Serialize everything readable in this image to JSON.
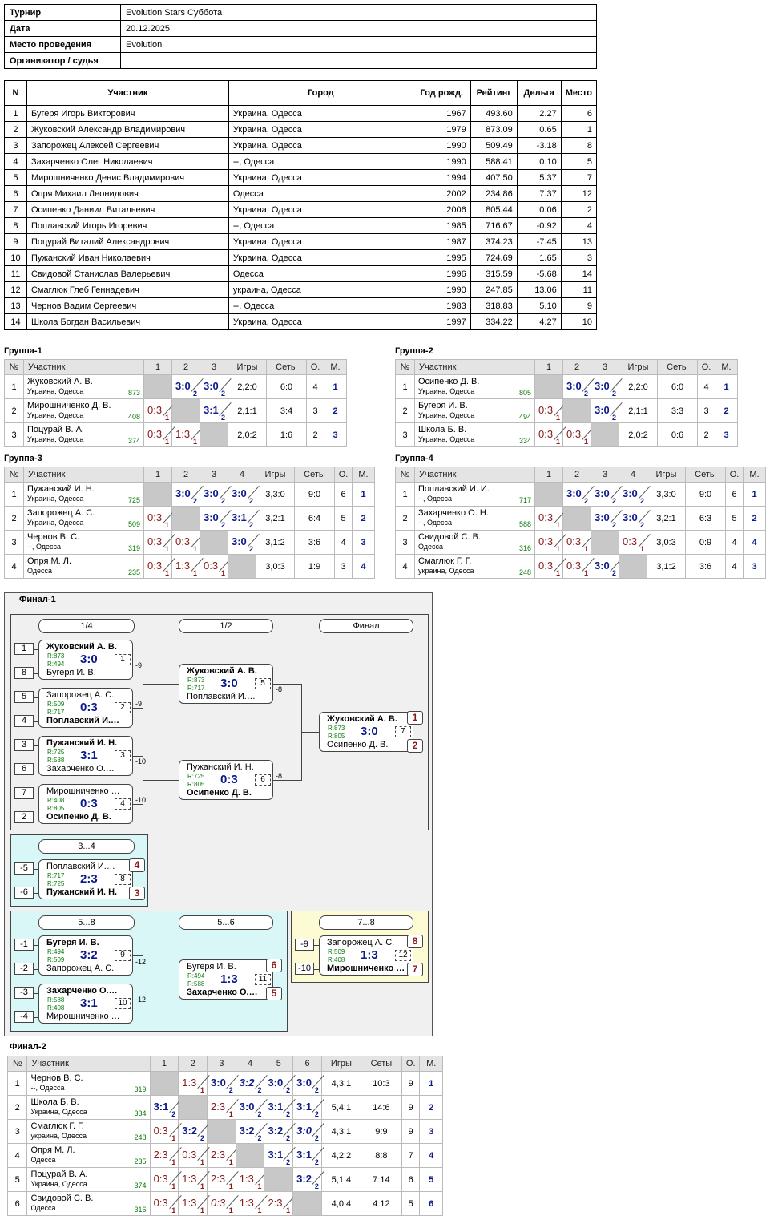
{
  "info": [
    {
      "k": "Турнир",
      "v": "Evolution Stars Суббота"
    },
    {
      "k": "Дата",
      "v": "20.12.2025"
    },
    {
      "k": "Место проведения",
      "v": "Evolution"
    },
    {
      "k": "Организатор / судья",
      "v": ""
    }
  ],
  "players_header": [
    "N",
    "Участник",
    "Город",
    "Год рожд.",
    "Рейтинг",
    "Дельта",
    "Место"
  ],
  "players": [
    [
      "1",
      "Бугеря Игорь Викторович",
      "Украина, Одесса",
      "1967",
      "493.60",
      "2.27",
      "6"
    ],
    [
      "2",
      "Жуковский Александр Владимирович",
      "Украина, Одесса",
      "1979",
      "873.09",
      "0.65",
      "1"
    ],
    [
      "3",
      "Запорожец Алексей Сергеевич",
      "Украина, Одесса",
      "1990",
      "509.49",
      "-3.18",
      "8"
    ],
    [
      "4",
      "Захарченко Олег Николаевич",
      "--, Одесса",
      "1990",
      "588.41",
      "0.10",
      "5"
    ],
    [
      "5",
      "Мирошниченко Денис Владимирович",
      "Украина, Одесса",
      "1994",
      "407.50",
      "5.37",
      "7"
    ],
    [
      "6",
      "Опря Михаил Леонидович",
      "Одесса",
      "2002",
      "234.86",
      "7.37",
      "12"
    ],
    [
      "7",
      "Осипенко Даниил Витальевич",
      "Украина, Одесса",
      "2006",
      "805.44",
      "0.06",
      "2"
    ],
    [
      "8",
      "Поплавский Игорь Игоревич",
      "--, Одесса",
      "1985",
      "716.67",
      "-0.92",
      "4"
    ],
    [
      "9",
      "Поцурай Виталий Александрович",
      "Украина, Одесса",
      "1987",
      "374.23",
      "-7.45",
      "13"
    ],
    [
      "10",
      "Пужанский Иван Николаевич",
      "Украина, Одесса",
      "1995",
      "724.69",
      "1.65",
      "3"
    ],
    [
      "11",
      "Свидовой Станислав Валерьевич",
      "Одесса",
      "1996",
      "315.59",
      "-5.68",
      "14"
    ],
    [
      "12",
      "Смаглюк Глеб Геннадевич",
      "украина, Одесса",
      "1990",
      "247.85",
      "13.06",
      "11"
    ],
    [
      "13",
      "Чернов Вадим Сергеевич",
      "--, Одесса",
      "1983",
      "318.83",
      "5.10",
      "9"
    ],
    [
      "14",
      "Школа Богдан Васильевич",
      "Украина, Одесса",
      "1997",
      "334.22",
      "4.27",
      "10"
    ]
  ],
  "grid_header": {
    "n": "№",
    "name": "Участник",
    "games": "Игры",
    "sets": "Сеты",
    "pts": "О.",
    "place": "М."
  },
  "groups": [
    {
      "title": "Группа-1",
      "rows": [
        {
          "n": "1",
          "name": "Жуковский А. В.",
          "city": "Украина, Одесса",
          "rating": "873",
          "res": [
            "X",
            "3:0|2|w",
            "3:0|2|w"
          ],
          "games": "2,2:0",
          "sets": "6:0",
          "pts": "4",
          "place": "1"
        },
        {
          "n": "2",
          "name": "Мирошниченко Д. В.",
          "city": "Украина, Одесса",
          "rating": "408",
          "res": [
            "0:3|1|l",
            "X",
            "3:1|2|w"
          ],
          "games": "2,1:1",
          "sets": "3:4",
          "pts": "3",
          "place": "2"
        },
        {
          "n": "3",
          "name": "Поцурай В. А.",
          "city": "Украина, Одесса",
          "rating": "374",
          "res": [
            "0:3|1|l",
            "1:3|1|l",
            "X"
          ],
          "games": "2,0:2",
          "sets": "1:6",
          "pts": "2",
          "place": "3"
        }
      ]
    },
    {
      "title": "Группа-2",
      "rows": [
        {
          "n": "1",
          "name": "Осипенко Д. В.",
          "city": "Украина, Одесса",
          "rating": "805",
          "res": [
            "X",
            "3:0|2|w",
            "3:0|2|w"
          ],
          "games": "2,2:0",
          "sets": "6:0",
          "pts": "4",
          "place": "1"
        },
        {
          "n": "2",
          "name": "Бугеря И. В.",
          "city": "Украина, Одесса",
          "rating": "494",
          "res": [
            "0:3|1|l",
            "X",
            "3:0|2|w"
          ],
          "games": "2,1:1",
          "sets": "3:3",
          "pts": "3",
          "place": "2"
        },
        {
          "n": "3",
          "name": "Школа Б. В.",
          "city": "Украина, Одесса",
          "rating": "334",
          "res": [
            "0:3|1|l",
            "0:3|1|l",
            "X"
          ],
          "games": "2,0:2",
          "sets": "0:6",
          "pts": "2",
          "place": "3"
        }
      ]
    },
    {
      "title": "Группа-3",
      "rows": [
        {
          "n": "1",
          "name": "Пужанский И. Н.",
          "city": "Украина, Одесса",
          "rating": "725",
          "res": [
            "X",
            "3:0|2|w",
            "3:0|2|w",
            "3:0|2|w"
          ],
          "games": "3,3:0",
          "sets": "9:0",
          "pts": "6",
          "place": "1"
        },
        {
          "n": "2",
          "name": "Запорожец А. С.",
          "city": "Украина, Одесса",
          "rating": "509",
          "res": [
            "0:3|1|l",
            "X",
            "3:0|2|w",
            "3:1|2|w"
          ],
          "games": "3,2:1",
          "sets": "6:4",
          "pts": "5",
          "place": "2"
        },
        {
          "n": "3",
          "name": "Чернов В. С.",
          "city": "--, Одесса",
          "rating": "319",
          "res": [
            "0:3|1|l",
            "0:3|1|l",
            "X",
            "3:0|2|w"
          ],
          "games": "3,1:2",
          "sets": "3:6",
          "pts": "4",
          "place": "3"
        },
        {
          "n": "4",
          "name": "Опря М. Л.",
          "city": "Одесса",
          "rating": "235",
          "res": [
            "0:3|1|l",
            "1:3|1|l",
            "0:3|1|l",
            "X"
          ],
          "games": "3,0:3",
          "sets": "1:9",
          "pts": "3",
          "place": "4"
        }
      ]
    },
    {
      "title": "Группа-4",
      "rows": [
        {
          "n": "1",
          "name": "Поплавский И. И.",
          "city": "--, Одесса",
          "rating": "717",
          "res": [
            "X",
            "3:0|2|w",
            "3:0|2|w",
            "3:0|2|w"
          ],
          "games": "3,3:0",
          "sets": "9:0",
          "pts": "6",
          "place": "1"
        },
        {
          "n": "2",
          "name": "Захарченко О. Н.",
          "city": "--, Одесса",
          "rating": "588",
          "res": [
            "0:3|1|l",
            "X",
            "3:0|2|w",
            "3:0|2|w"
          ],
          "games": "3,2:1",
          "sets": "6:3",
          "pts": "5",
          "place": "2"
        },
        {
          "n": "3",
          "name": "Свидовой С. В.",
          "city": "Одесса",
          "rating": "316",
          "res": [
            "0:3|1|l",
            "0:3|1|l",
            "X",
            "0:3|1|l"
          ],
          "games": "3,0:3",
          "sets": "0:9",
          "pts": "4",
          "place": "4"
        },
        {
          "n": "4",
          "name": "Смаглюк Г. Г.",
          "city": "украина, Одесса",
          "rating": "248",
          "res": [
            "0:3|1|l",
            "0:3|1|l",
            "3:0|2|w",
            "X"
          ],
          "games": "3,1:2",
          "sets": "3:6",
          "pts": "4",
          "place": "3"
        }
      ]
    }
  ],
  "final1": {
    "title": "Финал-1",
    "stages": [
      "1/4",
      "1/2",
      "Финал",
      "3...4",
      "5...8",
      "5...6",
      "7...8"
    ],
    "seeds": [
      "1",
      "8",
      "5",
      "4",
      "3",
      "6",
      "7",
      "2",
      "-5",
      "-6",
      "-1",
      "-2",
      "-3",
      "-4",
      "-9",
      "-10"
    ],
    "matches": [
      {
        "a": "Жуковский А. В.",
        "ra": "R:873",
        "b": "Бугеря И. В.",
        "rb": "R:494",
        "score": "3:0",
        "num": "1",
        "win": "a"
      },
      {
        "a": "Запорожец А. С.",
        "ra": "R:509",
        "b": "Поплавский И.…",
        "rb": "R:717",
        "score": "0:3",
        "num": "2",
        "win": "b"
      },
      {
        "a": "Пужанский И. Н.",
        "ra": "R:725",
        "b": "Захарченко О.…",
        "rb": "R:588",
        "score": "3:1",
        "num": "3",
        "win": "a"
      },
      {
        "a": "Мирошниченко …",
        "ra": "R:408",
        "b": "Осипенко Д. В.",
        "rb": "R:805",
        "score": "0:3",
        "num": "4",
        "win": "b"
      },
      {
        "a": "Жуковский А. В.",
        "ra": "R:873",
        "b": "Поплавский И.…",
        "rb": "R:717",
        "score": "3:0",
        "num": "5",
        "win": "a"
      },
      {
        "a": "Пужанский И. Н.",
        "ra": "R:725",
        "b": "Осипенко Д. В.",
        "rb": "R:805",
        "score": "0:3",
        "num": "6",
        "win": "b"
      },
      {
        "a": "Жуковский А. В.",
        "ra": "R:873",
        "b": "Осипенко Д. В.",
        "rb": "R:805",
        "score": "3:0",
        "num": "7",
        "win": "a"
      },
      {
        "a": "Поплавский И.…",
        "ra": "R:717",
        "b": "Пужанский И. Н.",
        "rb": "R:725",
        "score": "2:3",
        "num": "8",
        "win": "b"
      },
      {
        "a": "Бугеря И. В.",
        "ra": "R:494",
        "b": "Запорожец А. С.",
        "rb": "R:509",
        "score": "3:2",
        "num": "9",
        "win": "a"
      },
      {
        "a": "Захарченко О.…",
        "ra": "R:588",
        "b": "Мирошниченко …",
        "rb": "R:408",
        "score": "3:1",
        "num": "10",
        "win": "a"
      },
      {
        "a": "Бугеря И. В.",
        "ra": "R:494",
        "b": "Захарченко О.…",
        "rb": "R:588",
        "score": "1:3",
        "num": "11",
        "win": "b"
      },
      {
        "a": "Запорожец А. С.",
        "ra": "R:509",
        "b": "Мирошниченко …",
        "rb": "R:408",
        "score": "1:3",
        "num": "12",
        "win": "b"
      }
    ],
    "loser_labels": [
      "-9",
      "-9",
      "-10",
      "-10",
      "-8",
      "-8",
      "-12",
      "-12"
    ],
    "places": [
      "1",
      "2",
      "4",
      "3",
      "6",
      "5",
      "8",
      "7"
    ]
  },
  "final2": {
    "title": "Финал-2",
    "rows": [
      {
        "n": "1",
        "name": "Чернов В. С.",
        "city": "--, Одесса",
        "rating": "319",
        "res": [
          "X",
          "1:3|1|l",
          "3:0|2|w",
          "3:2|2|wi",
          "3:0|2|w",
          "3:0|2|w"
        ],
        "games": "4,3:1",
        "sets": "10:3",
        "pts": "9",
        "place": "1"
      },
      {
        "n": "2",
        "name": "Школа Б. В.",
        "city": "Украина, Одесса",
        "rating": "334",
        "res": [
          "3:1|2|w",
          "X",
          "2:3|1|l",
          "3:0|2|w",
          "3:1|2|w",
          "3:1|2|w"
        ],
        "games": "5,4:1",
        "sets": "14:6",
        "pts": "9",
        "place": "2"
      },
      {
        "n": "3",
        "name": "Смаглюк Г. Г.",
        "city": "украина, Одесса",
        "rating": "248",
        "res": [
          "0:3|1|l",
          "3:2|2|w",
          "X",
          "3:2|2|w",
          "3:2|2|w",
          "3:0|2|wi"
        ],
        "games": "4,3:1",
        "sets": "9:9",
        "pts": "9",
        "place": "3"
      },
      {
        "n": "4",
        "name": "Опря М. Л.",
        "city": "Одесса",
        "rating": "235",
        "res": [
          "2:3|1|l",
          "0:3|1|l",
          "2:3|1|l",
          "X",
          "3:1|2|w",
          "3:1|2|w"
        ],
        "games": "4,2:2",
        "sets": "8:8",
        "pts": "7",
        "place": "4"
      },
      {
        "n": "5",
        "name": "Поцурай В. А.",
        "city": "Украина, Одесса",
        "rating": "374",
        "res": [
          "0:3|1|l",
          "1:3|1|l",
          "2:3|1|l",
          "1:3|1|l",
          "X",
          "3:2|2|w"
        ],
        "games": "5,1:4",
        "sets": "7:14",
        "pts": "6",
        "place": "5"
      },
      {
        "n": "6",
        "name": "Свидовой С. В.",
        "city": "Одесса",
        "rating": "316",
        "res": [
          "0:3|1|l",
          "1:3|1|l",
          "0:3|1|li",
          "1:3|1|l",
          "2:3|1|l",
          "X"
        ],
        "games": "4,0:4",
        "sets": "4:12",
        "pts": "5",
        "place": "6"
      }
    ]
  }
}
